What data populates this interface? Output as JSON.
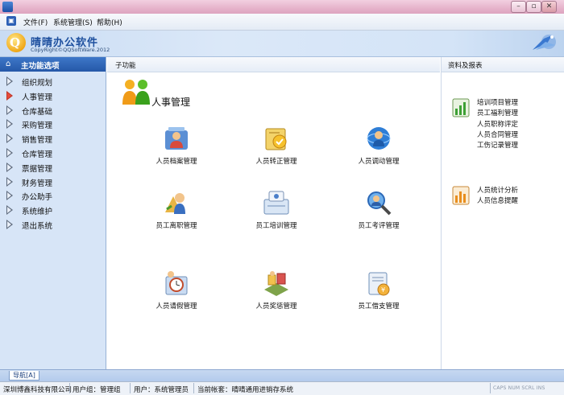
{
  "menu": {
    "items": [
      "文件(F)",
      "系统管理(S)",
      "帮助(H)"
    ]
  },
  "header": {
    "app_name": "晴晴办公软件",
    "copyright": "CopyRight©QQSoftWare.2012"
  },
  "sidebar": {
    "title": "主功能选项",
    "items": [
      {
        "label": "组织规划"
      },
      {
        "label": "人事管理",
        "active": true
      },
      {
        "label": "仓库基础"
      },
      {
        "label": "采购管理"
      },
      {
        "label": "销售管理"
      },
      {
        "label": "仓库管理"
      },
      {
        "label": "票据管理"
      },
      {
        "label": "财务管理"
      },
      {
        "label": "办公助手"
      },
      {
        "label": "系统维护"
      },
      {
        "label": "退出系统"
      }
    ]
  },
  "main": {
    "section_label": "子功能",
    "page_title": "人事管理",
    "functions": [
      {
        "label": "人员档案管理",
        "icon": "personnel-files-icon"
      },
      {
        "label": "人员转正管理",
        "icon": "regularization-icon"
      },
      {
        "label": "人员调动管理",
        "icon": "transfer-icon"
      },
      {
        "label": "员工离职管理",
        "icon": "resignation-icon"
      },
      {
        "label": "员工培训管理",
        "icon": "training-icon"
      },
      {
        "label": "员工考评管理",
        "icon": "evaluation-icon"
      },
      {
        "label": "人员请假管理",
        "icon": "leave-icon"
      },
      {
        "label": "人员奖惩管理",
        "icon": "reward-punish-icon"
      },
      {
        "label": "员工借支管理",
        "icon": "advance-icon"
      }
    ]
  },
  "reports": {
    "title": "资料及报表",
    "group1": [
      "培训项目管理",
      "员工福利管理",
      "人员职称评定",
      "人员合同管理",
      "工伤记录管理"
    ],
    "group2": [
      "人员统计分析",
      "人员信息提醒"
    ]
  },
  "nav_tab": {
    "label": "导航[A]"
  },
  "status": {
    "company": "深圳博鑫科技有限公司",
    "user_group": "用户组：管理组",
    "user": "用户：系统管理员",
    "account": "当前帐套：晴晴通用进销存系统",
    "keys": "CAPS NUM SCRL INS"
  }
}
